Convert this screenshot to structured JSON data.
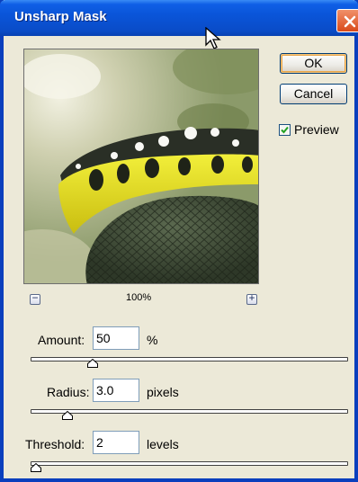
{
  "window": {
    "title": "Unsharp Mask"
  },
  "buttons": {
    "ok": "OK",
    "cancel": "Cancel"
  },
  "preview": {
    "label": "Preview",
    "checked": true
  },
  "zoom": {
    "minus": "−",
    "plus": "+",
    "level": "100%"
  },
  "amount": {
    "label": "Amount:",
    "value": "50",
    "unit": "%",
    "slider_fraction": 0.19
  },
  "radius": {
    "label": "Radius:",
    "value": "3.0",
    "unit": "pixels",
    "slider_fraction": 0.11
  },
  "threshold": {
    "label": "Threshold:",
    "value": "2",
    "unit": "levels",
    "slider_fraction": 0.01
  }
}
